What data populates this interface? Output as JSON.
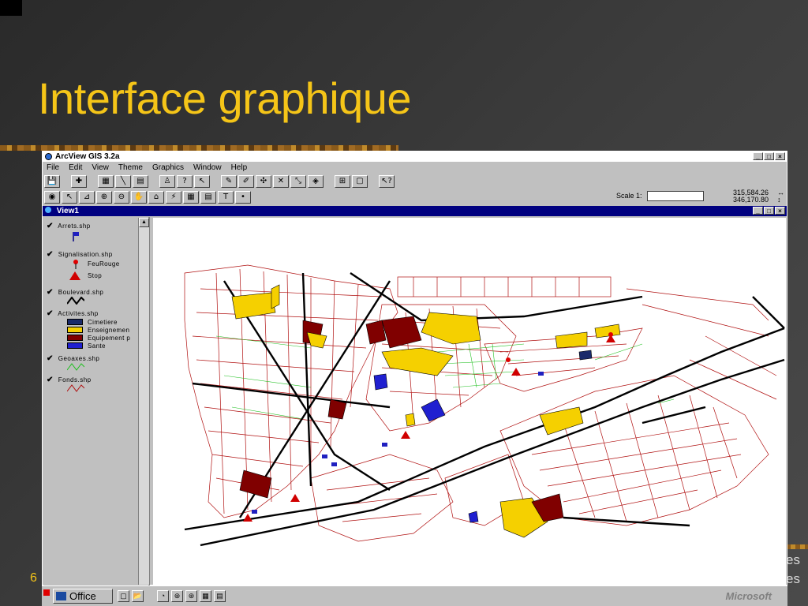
{
  "slide": {
    "title": "Interface graphique",
    "number": "6",
    "side_text_1": "es",
    "side_text_2": "es"
  },
  "app": {
    "title": "ArcView GIS 3.2a",
    "menus": [
      "File",
      "Edit",
      "View",
      "Theme",
      "Graphics",
      "Window",
      "Help"
    ],
    "scale_label": "Scale 1:",
    "scale_value": "",
    "coord_x": "315,584.26",
    "coord_y": "346,170.80",
    "coord_x_arrow": "↔",
    "coord_y_arrow": "↕",
    "window_buttons": [
      "_",
      "□",
      "×"
    ]
  },
  "toolbar1": [
    "💾",
    "✚",
    "▦",
    "╲",
    "▤",
    "♙",
    "?",
    "↖",
    "✎",
    "✐",
    "✣",
    "✕",
    "⤡",
    "◈",
    "⊞",
    "▢",
    "↖?"
  ],
  "toolbar2": [
    "◉",
    "↖",
    "⊿",
    "⊕",
    "⊖",
    "✋",
    "⌂",
    "⚡",
    "▦",
    "▤",
    "T",
    "•"
  ],
  "view": {
    "title": "View1"
  },
  "legend": {
    "layers": [
      {
        "name": "Arrets.shp",
        "checked": "✔"
      },
      {
        "name": "Signalisation.shp",
        "checked": "✔",
        "items": [
          "FeuRouge",
          "Stop"
        ]
      },
      {
        "name": "Boulevard.shp",
        "checked": "✔"
      },
      {
        "name": "Activites.shp",
        "checked": "✔",
        "items": [
          "Cimetiere",
          "Enseignemen",
          "Equipement p",
          "Sante"
        ]
      },
      {
        "name": "Geoaxes.shp",
        "checked": "✔"
      },
      {
        "name": "Fonds.shp",
        "checked": "✔"
      }
    ],
    "colors": {
      "cimetiere": "#1a2a6a",
      "enseignement": "#f5d000",
      "equipement": "#800000",
      "sante": "#2020d0",
      "fonds": "#b01010",
      "geoaxes": "#20c020"
    }
  },
  "taskbar": {
    "office_label": "Office",
    "brand": "Microsoft"
  }
}
